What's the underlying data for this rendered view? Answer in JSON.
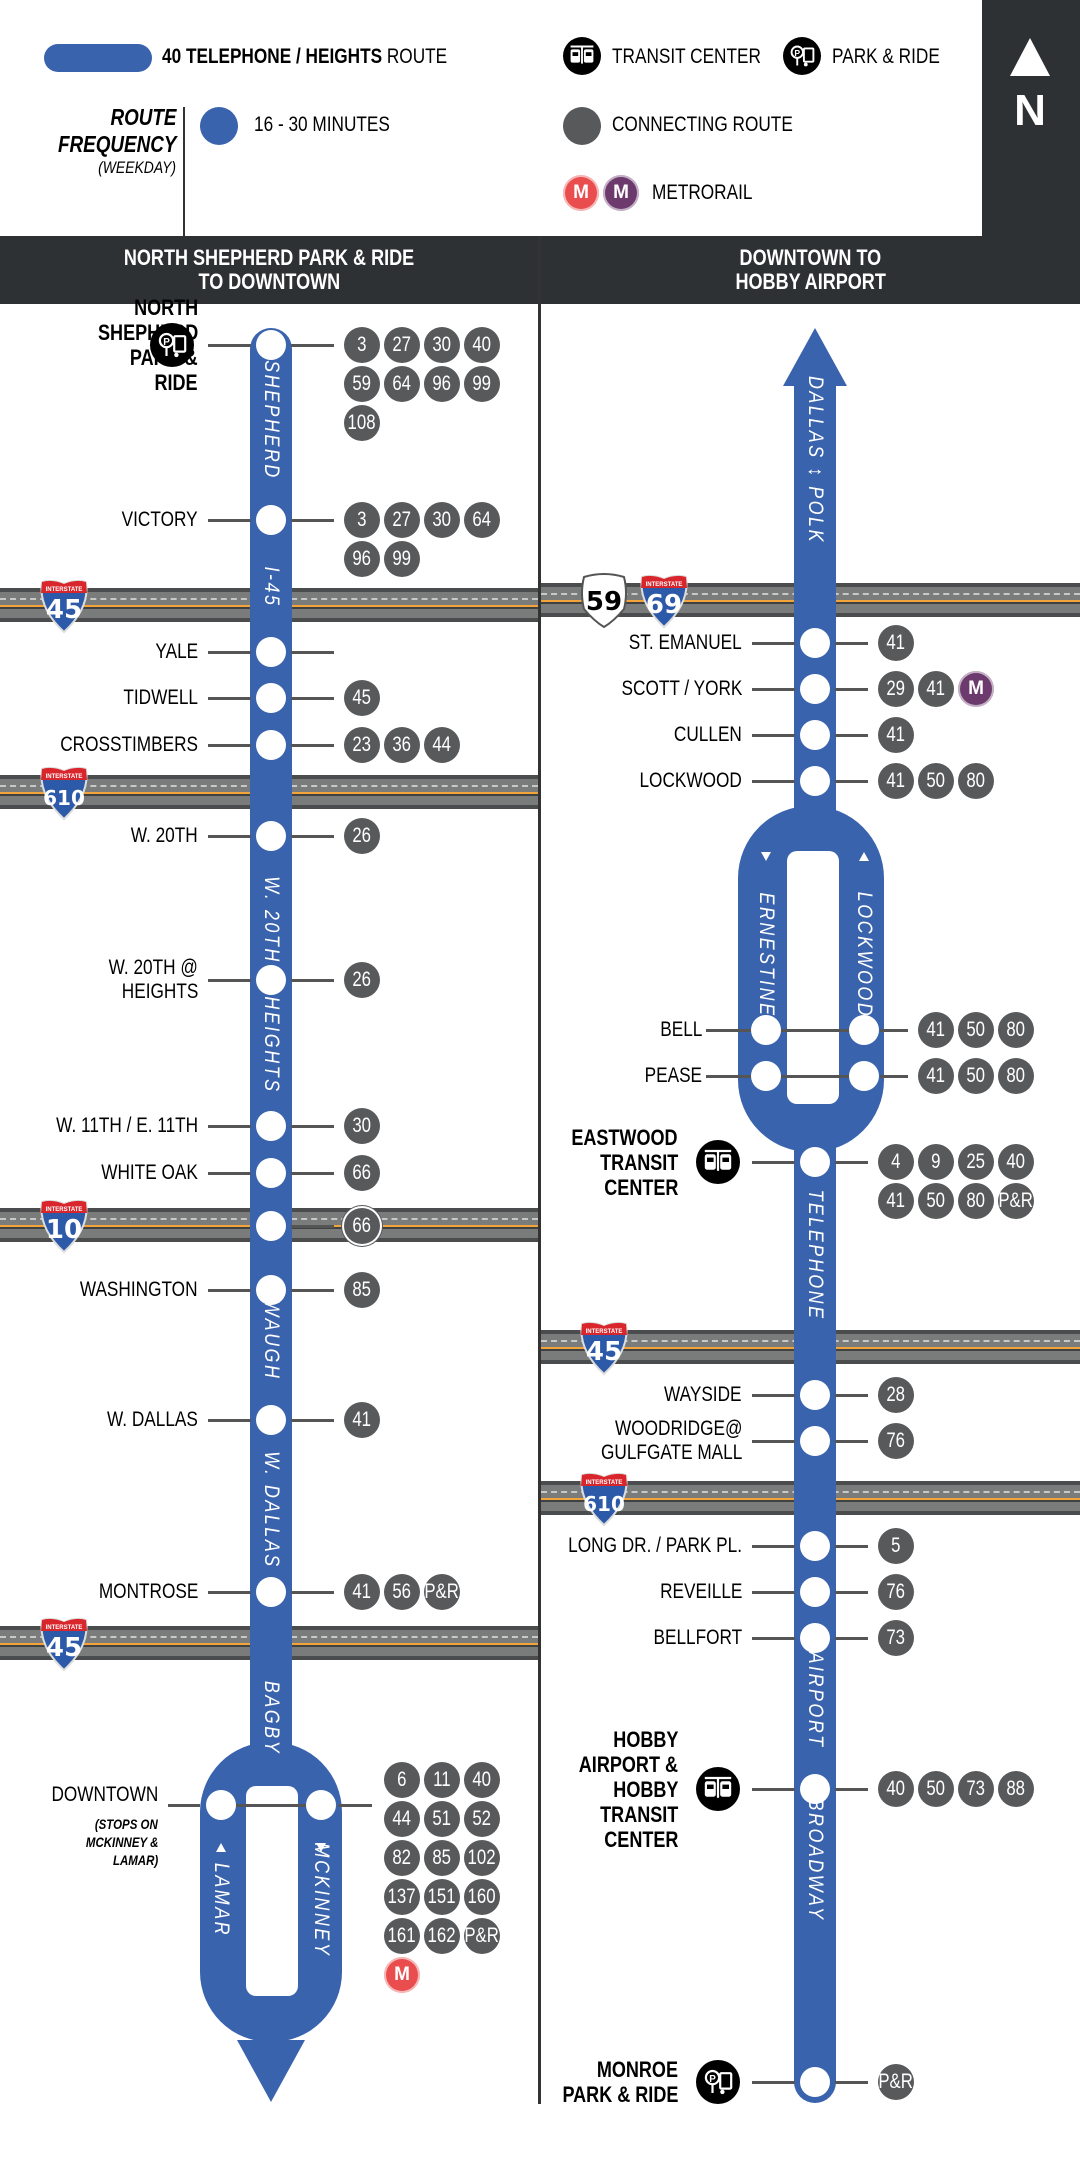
{
  "colors": {
    "route": "#3a63ae",
    "connecting": "#58595b",
    "header": "#2e3133",
    "metro_red": "#e94d4d",
    "metro_purple": "#6d3a6e",
    "highway": "#7a7c7c",
    "highway_center": "#f2a33a"
  },
  "legend": {
    "route_name_bold": "40 TELEPHONE / HEIGHTS",
    "route_name_suffix": "ROUTE",
    "frequency_title_1": "ROUTE",
    "frequency_title_2": "FREQUENCY",
    "frequency_subtitle": "(WEEKDAY)",
    "frequency_value": "16 - 30 MINUTES",
    "transit_center": "TRANSIT CENTER",
    "park_ride": "PARK & RIDE",
    "connecting_route": "CONNECTING ROUTE",
    "metrorail": "METRORAIL",
    "metrorail_letter": "M"
  },
  "compass": {
    "label": "N"
  },
  "left": {
    "header_line1": "NORTH SHEPHERD PARK & RIDE",
    "header_line2": "TO DOWNTOWN",
    "streets": [
      "SHEPHERD",
      "I-45",
      "W. 20TH",
      "HEIGHTS",
      "WAUGH",
      "W. DALLAS",
      "BAGBY",
      "LAMAR",
      "MCKINNEY"
    ],
    "highways": [
      "45",
      "610",
      "10",
      "45"
    ],
    "shield_top": "INTERSTATE",
    "stops": [
      {
        "name": [
          "NORTH",
          "SHEPHERD",
          "PARK &",
          "RIDE"
        ],
        "icon": "park-ride",
        "routes": [
          "3",
          "27",
          "30",
          "40",
          "59",
          "64",
          "96",
          "99",
          "108"
        ]
      },
      {
        "name": [
          "VICTORY"
        ],
        "routes": [
          "3",
          "27",
          "30",
          "64",
          "96",
          "99"
        ]
      },
      {
        "name": [
          "YALE"
        ],
        "routes": []
      },
      {
        "name": [
          "TIDWELL"
        ],
        "routes": [
          "45"
        ]
      },
      {
        "name": [
          "CROSSTIMBERS"
        ],
        "routes": [
          "23",
          "36",
          "44"
        ]
      },
      {
        "name": [
          "W. 20TH"
        ],
        "routes": [
          "26"
        ]
      },
      {
        "name": [
          "W. 20TH @",
          "HEIGHTS"
        ],
        "routes": [
          "26"
        ]
      },
      {
        "name": [
          "W. 11TH / E. 11TH"
        ],
        "routes": [
          "30"
        ]
      },
      {
        "name": [
          "WHITE OAK"
        ],
        "routes": [
          "66"
        ]
      },
      {
        "name": [],
        "routes": [
          "66"
        ]
      },
      {
        "name": [
          "WASHINGTON"
        ],
        "routes": [
          "85"
        ]
      },
      {
        "name": [
          "W. DALLAS"
        ],
        "routes": [
          "41"
        ]
      },
      {
        "name": [
          "MONTROSE"
        ],
        "routes": [
          "41",
          "56",
          "P&R"
        ]
      },
      {
        "name": [
          "DOWNTOWN"
        ],
        "note": [
          "(STOPS ON",
          "MCKINNEY &",
          "LAMAR)"
        ],
        "routes": [
          "6",
          "11",
          "40",
          "44",
          "51",
          "52",
          "82",
          "85",
          "102",
          "137",
          "151",
          "160",
          "161",
          "162",
          "P&R"
        ],
        "rail": "M"
      }
    ]
  },
  "right": {
    "header_line1": "DOWNTOWN TO",
    "header_line2": "HOBBY AIRPORT",
    "streets": [
      "DALLAS ↕ POLK",
      "ERNESTINE",
      "LOCKWOOD",
      "TELEPHONE",
      "AIRPORT",
      "BROADWAY"
    ],
    "highways": [
      "59",
      "69",
      "45",
      "610"
    ],
    "shield_top": "INTERSTATE",
    "stops": [
      {
        "name": [
          "ST. EMANUEL"
        ],
        "routes": [
          "41"
        ]
      },
      {
        "name": [
          "SCOTT / YORK"
        ],
        "routes": [
          "29",
          "41"
        ],
        "rail": "M"
      },
      {
        "name": [
          "CULLEN"
        ],
        "routes": [
          "41"
        ]
      },
      {
        "name": [
          "LOCKWOOD"
        ],
        "routes": [
          "41",
          "50",
          "80"
        ]
      },
      {
        "name": [
          "BELL"
        ],
        "routes": [
          "41",
          "50",
          "80"
        ]
      },
      {
        "name": [
          "PEASE"
        ],
        "routes": [
          "41",
          "50",
          "80"
        ]
      },
      {
        "name": [
          "EASTWOOD",
          "TRANSIT",
          "CENTER"
        ],
        "icon": "transit-center",
        "routes": [
          "4",
          "9",
          "25",
          "40",
          "41",
          "50",
          "80",
          "P&R"
        ]
      },
      {
        "name": [
          "WAYSIDE"
        ],
        "routes": [
          "28"
        ]
      },
      {
        "name": [
          "WOODRIDGE@",
          "GULFGATE MALL"
        ],
        "routes": [
          "76"
        ]
      },
      {
        "name": [
          "LONG DR. / PARK PL."
        ],
        "routes": [
          "5"
        ]
      },
      {
        "name": [
          "REVEILLE"
        ],
        "routes": [
          "76"
        ]
      },
      {
        "name": [
          "BELLFORT"
        ],
        "routes": [
          "73"
        ]
      },
      {
        "name": [
          "HOBBY",
          "AIRPORT &",
          "HOBBY",
          "TRANSIT",
          "CENTER"
        ],
        "icon": "transit-center",
        "routes": [
          "40",
          "50",
          "73",
          "88"
        ]
      },
      {
        "name": [
          "MONROE",
          "PARK & RIDE"
        ],
        "icon": "park-ride",
        "routes": [
          "P&R"
        ]
      }
    ]
  }
}
